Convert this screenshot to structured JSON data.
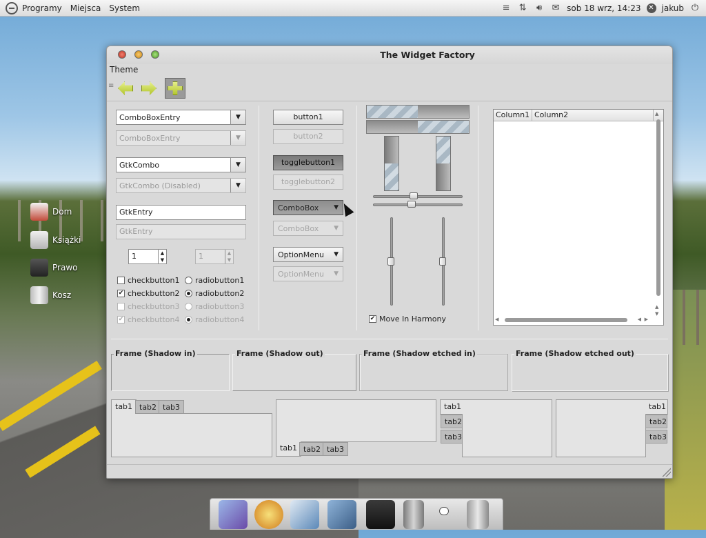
{
  "top_panel": {
    "menus": [
      "Programy",
      "Miejsca",
      "System"
    ],
    "clock": "sob 18 wrz, 14:23",
    "user": "jakub",
    "icons": [
      "network-arrows-icon",
      "volume-icon",
      "mail-icon",
      "user-status-icon",
      "power-icon"
    ]
  },
  "desktop": {
    "icons": [
      {
        "label": "Dom",
        "icon": "home-icon"
      },
      {
        "label": "Książki",
        "icon": "books-icon"
      },
      {
        "label": "Prawo",
        "icon": "typewriter-icon"
      },
      {
        "label": "Kosz",
        "icon": "trash-icon"
      }
    ]
  },
  "window": {
    "title": "The Widget Factory",
    "menu": "Theme",
    "left": {
      "combo1": "ComboBoxEntry",
      "combo1_dis": "ComboBoxEntry",
      "combo2": "GtkCombo",
      "combo2_dis": "GtkCombo (Disabled)",
      "entry": "GtkEntry",
      "entry_dis": "GtkEntry",
      "spin": "1",
      "spin_dis": "1",
      "checks": [
        {
          "label": "checkbutton1",
          "checked": false,
          "enabled": true
        },
        {
          "label": "checkbutton2",
          "checked": true,
          "enabled": true
        },
        {
          "label": "checkbutton3",
          "checked": false,
          "enabled": false
        },
        {
          "label": "checkbutton4",
          "checked": true,
          "enabled": false
        }
      ],
      "radios": [
        {
          "label": "radiobutton1",
          "checked": false,
          "enabled": true
        },
        {
          "label": "radiobutton2",
          "checked": true,
          "enabled": true
        },
        {
          "label": "radiobutton3",
          "checked": false,
          "enabled": false
        },
        {
          "label": "radiobutton4",
          "checked": true,
          "enabled": false
        }
      ]
    },
    "middle": {
      "button1": "button1",
      "button2": "button2",
      "toggle1": "togglebutton1",
      "toggle2": "togglebutton2",
      "combobox": "ComboBox",
      "combobox_dis": "ComboBox",
      "option": "OptionMenu",
      "option_dis": "OptionMenu"
    },
    "progress": {
      "horizontal": [
        0.5,
        0.5
      ],
      "vertical": [
        0.5,
        0.5
      ],
      "hscales": [
        0.45,
        0.42
      ],
      "vscales": [
        0.5,
        0.5
      ],
      "harmony_label": "Move In Harmony",
      "harmony_checked": true
    },
    "tree": {
      "columns": [
        "Column1",
        "Column2"
      ]
    },
    "frames": [
      "Frame (Shadow in)",
      "Frame (Shadow out)",
      "Frame (Shadow etched in)",
      "Frame (Shadow etched out)"
    ],
    "tabs": [
      "tab1",
      "tab2",
      "tab3"
    ]
  },
  "colors": {
    "accent_green": "#b3c62e",
    "progress": "#a9b8c4"
  }
}
